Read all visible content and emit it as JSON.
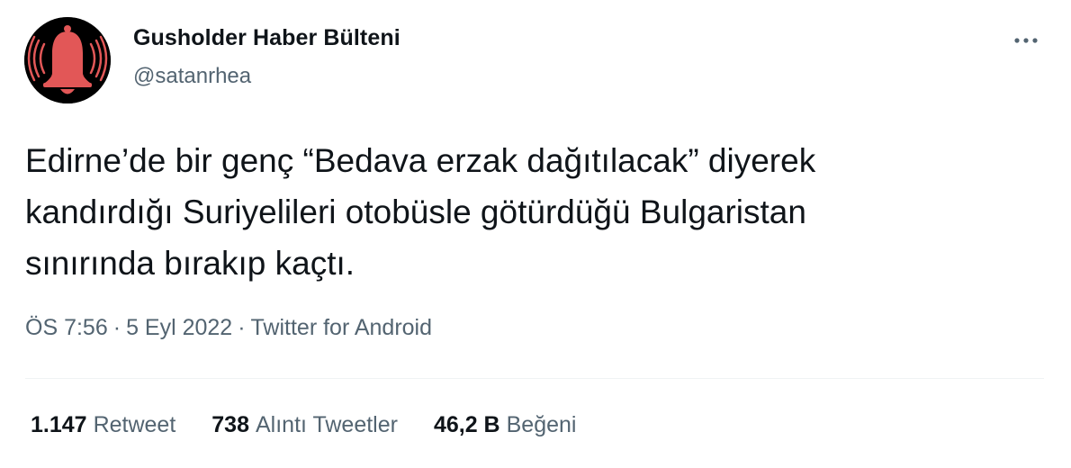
{
  "author": {
    "display_name": "Gusholder Haber Bülteni",
    "handle": "@satanrhea",
    "avatar_icon": "alarm-bell-icon",
    "avatar_colors": {
      "background": "#000000",
      "bell": "#e25757"
    }
  },
  "menu": {
    "more_icon": "more-horizontal-icon"
  },
  "tweet": {
    "text": "Edirne’de bir genç “Bedava erzak dağıtılacak” diyerek\nkandırdığı Suriyelileri otobüsle götürdüğü Bulgaristan\nsınırında bırakıp kaçtı."
  },
  "meta": {
    "time": "ÖS 7:56",
    "separator": "·",
    "date": "5 Eyl 2022",
    "source": "Twitter for Android"
  },
  "stats": {
    "retweets_count": "1.147",
    "retweets_label": "Retweet",
    "quotes_count": "738",
    "quotes_label": "Alıntı Tweetler",
    "likes_count": "46,2 B",
    "likes_label": "Beğeni"
  },
  "colors": {
    "text_primary": "#0f1419",
    "text_secondary": "#536471",
    "divider": "#eff3f4"
  }
}
